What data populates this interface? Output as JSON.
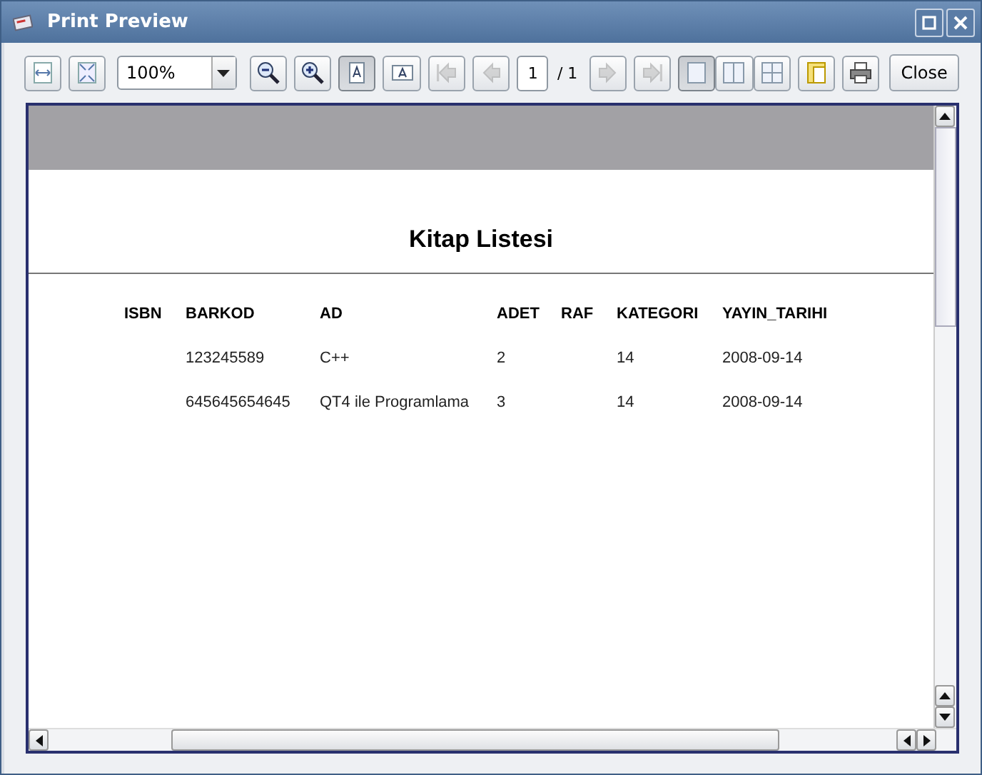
{
  "window": {
    "title": "Print Preview"
  },
  "toolbar": {
    "tools": [
      {
        "kind": "fit-width",
        "selected": false,
        "disabled": false
      },
      {
        "kind": "fit-page",
        "selected": false,
        "disabled": false
      },
      {
        "kind": "zoom-combo",
        "value": "100%"
      },
      {
        "kind": "zoom-out",
        "selected": false,
        "disabled": false
      },
      {
        "kind": "zoom-in",
        "selected": false,
        "disabled": false
      },
      {
        "kind": "portrait",
        "selected": true,
        "disabled": false
      },
      {
        "kind": "landscape",
        "selected": false,
        "disabled": false
      },
      {
        "kind": "first",
        "selected": false,
        "disabled": true
      },
      {
        "kind": "prev",
        "selected": false,
        "disabled": true
      },
      {
        "kind": "page-field",
        "value": "1",
        "total": "/ 1"
      },
      {
        "kind": "next",
        "selected": false,
        "disabled": true
      },
      {
        "kind": "last",
        "selected": false,
        "disabled": true
      },
      {
        "kind": "single",
        "selected": true,
        "disabled": false
      },
      {
        "kind": "facing",
        "selected": false,
        "disabled": false
      },
      {
        "kind": "overview",
        "selected": false,
        "disabled": false
      },
      {
        "kind": "page-setup",
        "selected": false,
        "disabled": false
      },
      {
        "kind": "print",
        "selected": false,
        "disabled": false
      },
      {
        "kind": "text-button",
        "label": "Close"
      }
    ]
  },
  "page": {
    "title": "Kitap Listesi",
    "columns": [
      "ISBN",
      "BARKOD",
      "AD",
      "ADET",
      "RAF",
      "KATEGORI",
      "YAYIN_TARIHI"
    ],
    "rows": [
      [
        null,
        "123245589",
        "C++",
        "2",
        null,
        "14",
        "2008-09-14"
      ],
      [
        null,
        "645645654645",
        "QT4 ile Programlama",
        "3",
        null,
        "14",
        "2008-09-14"
      ]
    ]
  }
}
